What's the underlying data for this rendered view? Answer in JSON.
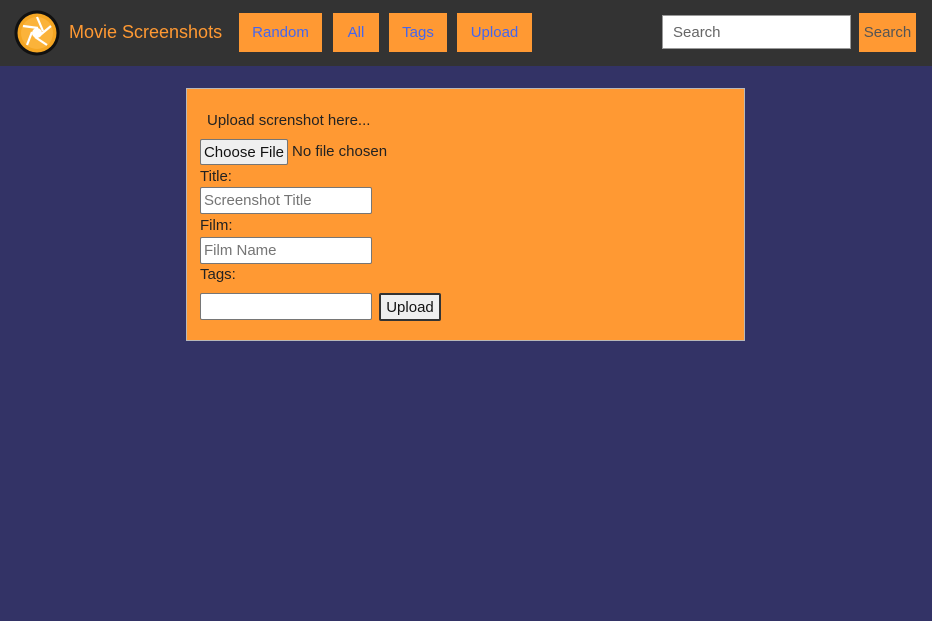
{
  "header": {
    "logo_icon": "camera-aperture-icon",
    "brand": "Movie Screenshots",
    "nav": [
      {
        "label": "Random"
      },
      {
        "label": "All"
      },
      {
        "label": "Tags"
      },
      {
        "label": "Upload"
      }
    ],
    "search": {
      "placeholder": "Search",
      "value": "",
      "button_label": "Search"
    }
  },
  "upload_form": {
    "heading": "Upload screnshot here...",
    "file_button": "Choose File",
    "file_status": "No file chosen",
    "title_label": "Title:",
    "title_placeholder": "Screenshot Title",
    "film_label": "Film:",
    "film_placeholder": "Film Name",
    "tags_label": "Tags:",
    "tags_value": "",
    "submit_label": "Upload"
  },
  "colors": {
    "accent": "#ff9933",
    "header_bg": "#333333",
    "page_bg": "#333366",
    "nav_text": "#4466ee"
  }
}
